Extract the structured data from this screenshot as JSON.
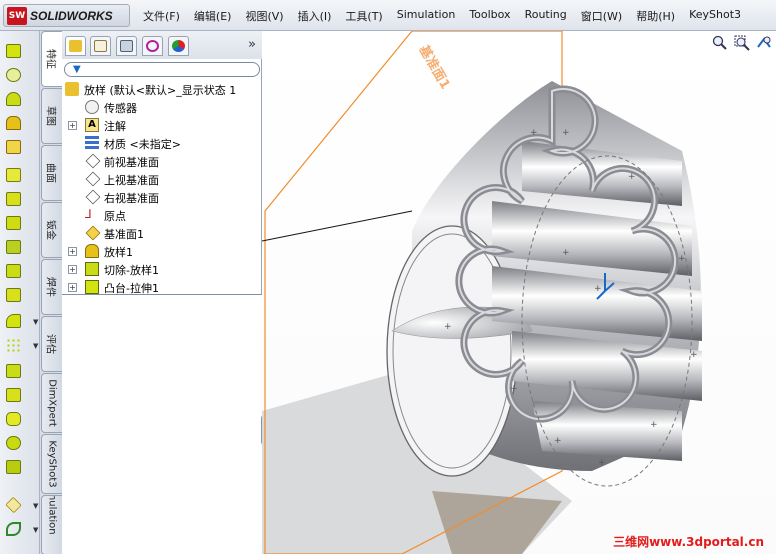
{
  "app": {
    "logo_text": "SOLIDWORKS",
    "logo_badge": "SW"
  },
  "menu": {
    "items": [
      "文件(F)",
      "编辑(E)",
      "视图(V)",
      "插入(I)",
      "工具(T)",
      "Simulation",
      "Toolbox",
      "Routing",
      "窗口(W)",
      "帮助(H)",
      "KeyShot3"
    ]
  },
  "left_tabs": [
    "特征",
    "草图",
    "曲面",
    "钣金",
    "焊件",
    "评估",
    "DimXpert",
    "KeyShot3",
    "Simulation"
  ],
  "feature_tree": {
    "root": "放样   (默认<默认>_显示状态 1",
    "items": [
      {
        "label": "传感器",
        "icon": "sensor-icon"
      },
      {
        "label": "注解",
        "icon": "annotation-icon"
      },
      {
        "label": "材质 <未指定>",
        "icon": "material-icon"
      },
      {
        "label": "前视基准面",
        "icon": "plane-icon"
      },
      {
        "label": "上视基准面",
        "icon": "plane-icon"
      },
      {
        "label": "右视基准面",
        "icon": "plane-icon"
      },
      {
        "label": "原点",
        "icon": "origin-icon"
      },
      {
        "label": "基准面1",
        "icon": "plane-icon"
      },
      {
        "label": "放样1",
        "icon": "loft-icon"
      },
      {
        "label": "切除-放样1",
        "icon": "cut-loft-icon"
      },
      {
        "label": "凸台-拉伸1",
        "icon": "boss-extrude-icon"
      }
    ]
  },
  "viewport": {
    "plane_label": "基准面1",
    "watermark": "三维网www.3dportal.cn"
  },
  "colors": {
    "plane_orange": "#f28c2a",
    "accent_blue": "#1769c8",
    "watermark_red": "#e31b1b",
    "feature_green": "#c7d600"
  }
}
